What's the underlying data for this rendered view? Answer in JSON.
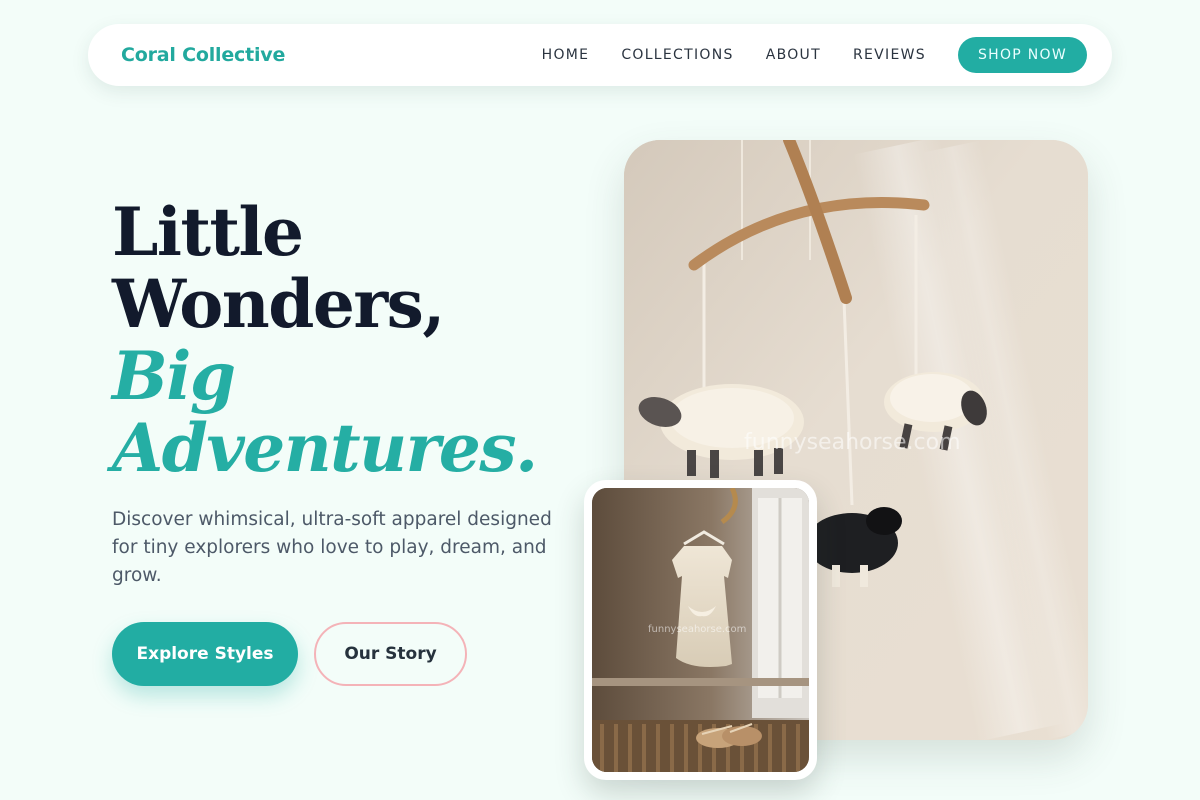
{
  "brand": "Coral Collective",
  "nav": {
    "links": [
      "HOME",
      "COLLECTIONS",
      "ABOUT",
      "REVIEWS"
    ],
    "cta": "SHOP NOW"
  },
  "hero": {
    "line1": "Little",
    "line2": "Wonders,",
    "line3": "Big",
    "line4": "Adventures.",
    "description": "Discover whimsical, ultra-soft apparel designed for tiny explorers who love to play, dream, and grow.",
    "primary_button": "Explore Styles",
    "secondary_button": "Our Story"
  },
  "images": {
    "main_watermark": "funnyseahorse.com",
    "small_watermark": "funnyseahorse.com"
  },
  "colors": {
    "accent": "#22ada3",
    "headline": "#121a2c",
    "outline": "#f4b3b8",
    "background": "#f3fdf9"
  }
}
